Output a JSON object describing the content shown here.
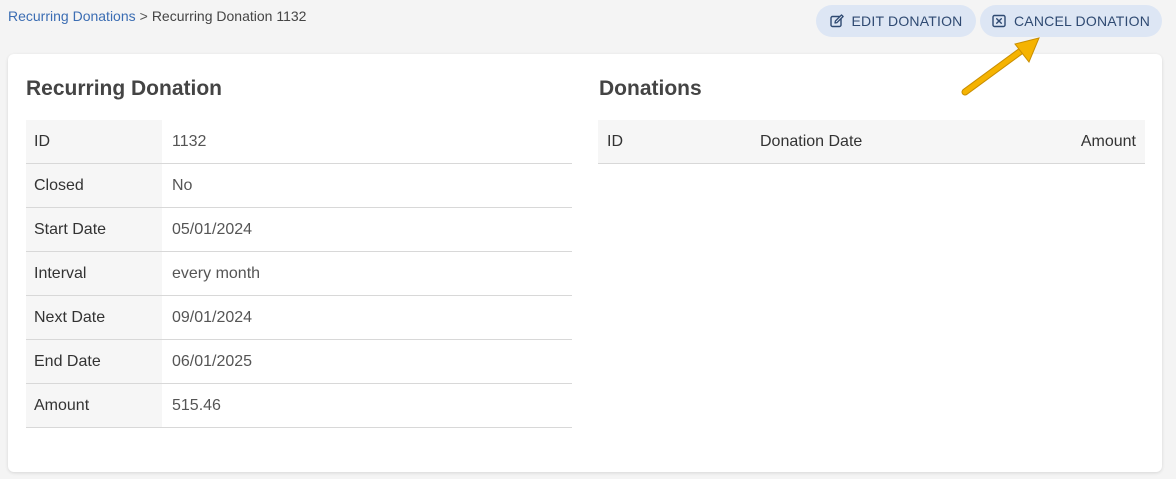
{
  "breadcrumb": {
    "parent": "Recurring Donations",
    "separator": ">",
    "current": "Recurring Donation 1132"
  },
  "actions": {
    "edit_label": "EDIT DONATION",
    "edit_icon": "edit-icon",
    "cancel_label": "CANCEL DONATION",
    "cancel_icon": "close-box-icon"
  },
  "recurring": {
    "title": "Recurring Donation",
    "fields": [
      {
        "label": "ID",
        "value": "1132"
      },
      {
        "label": "Closed",
        "value": "No"
      },
      {
        "label": "Start Date",
        "value": "05/01/2024"
      },
      {
        "label": "Interval",
        "value": "every month"
      },
      {
        "label": "Next Date",
        "value": "09/01/2024"
      },
      {
        "label": "End Date",
        "value": "06/01/2025"
      },
      {
        "label": "Amount",
        "value": "515.46"
      }
    ]
  },
  "donations": {
    "title": "Donations",
    "columns": [
      "ID",
      "Donation Date",
      "Amount"
    ],
    "rows": []
  },
  "colors": {
    "link": "#3b6db3",
    "button_bg": "#dde6f4",
    "button_text": "#2f4a72",
    "arrow": "#f5b301"
  }
}
